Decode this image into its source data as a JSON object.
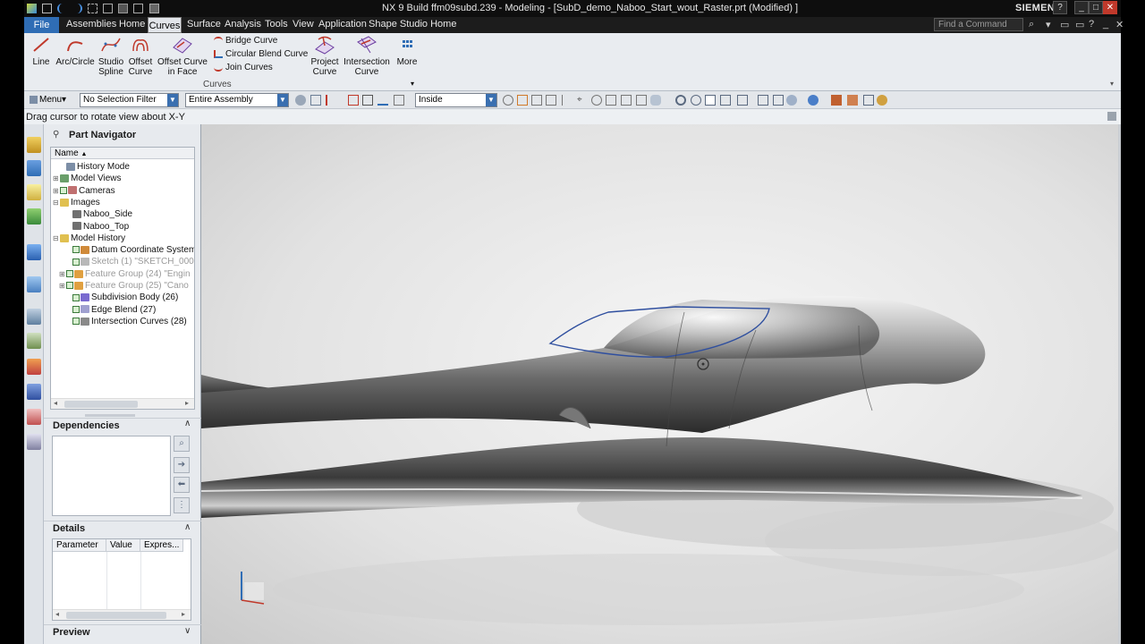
{
  "titlebar": {
    "title": "NX 9  Build ffm09subd.239 - Modeling - [SubD_demo_Naboo_Start_wout_Raster.prt (Modified) ]",
    "brand": "SIEMENS",
    "window_buttons": [
      "?",
      "_",
      "□",
      "✕"
    ]
  },
  "menubar": {
    "file": "File",
    "items": [
      "Assemblies",
      "Home",
      "Curves",
      "Surface",
      "Analysis",
      "Tools",
      "View",
      "Application",
      "Shape Studio Home"
    ],
    "active": "Curves",
    "find_placeholder": "Find a Command"
  },
  "ribbon": {
    "buttons": [
      {
        "label": "Line",
        "icon": "line-icon"
      },
      {
        "label": "Arc/Circle",
        "icon": "arc-icon"
      },
      {
        "label": "Studio\nSpline",
        "icon": "spline-icon"
      },
      {
        "label": "Offset\nCurve",
        "icon": "offset-curve-icon"
      },
      {
        "label": "Offset Curve\nin Face",
        "icon": "offset-in-face-icon"
      },
      {
        "label": "Project\nCurve",
        "icon": "project-curve-icon"
      },
      {
        "label": "Intersection\nCurve",
        "icon": "intersection-curve-icon"
      },
      {
        "label": "More",
        "icon": "more-icon"
      }
    ],
    "small_buttons": [
      "Bridge Curve",
      "Circular Blend Curve",
      "Join Curves"
    ],
    "group_label": "Curves"
  },
  "toolbar": {
    "menu_label": "Menu▾",
    "selection_filter": "No Selection Filter",
    "scope": "Entire Assembly",
    "inside": "Inside"
  },
  "status": {
    "message": "Drag cursor to rotate view about X-Y"
  },
  "navigator": {
    "title": "Part Navigator",
    "column": "Name",
    "rows": [
      {
        "label": "History Mode",
        "indent": 1,
        "twisty": "",
        "check": false,
        "icon": "clock-icon",
        "dim": false
      },
      {
        "label": "Model Views",
        "indent": 0,
        "twisty": "+",
        "check": false,
        "icon": "views-icon",
        "dim": false
      },
      {
        "label": "Cameras",
        "indent": 0,
        "twisty": "+",
        "check": true,
        "icon": "camera-icon",
        "dim": false
      },
      {
        "label": "Images",
        "indent": 0,
        "twisty": "-",
        "check": false,
        "icon": "folder-icon",
        "dim": false
      },
      {
        "label": "Naboo_Side",
        "indent": 2,
        "twisty": "",
        "check": false,
        "icon": "image-icon",
        "dim": false
      },
      {
        "label": "Naboo_Top",
        "indent": 2,
        "twisty": "",
        "check": false,
        "icon": "image-icon",
        "dim": false
      },
      {
        "label": "Model History",
        "indent": 0,
        "twisty": "-",
        "check": false,
        "icon": "folder-icon",
        "dim": false
      },
      {
        "label": "Datum Coordinate System",
        "indent": 2,
        "twisty": "",
        "check": true,
        "icon": "datum-icon",
        "dim": false
      },
      {
        "label": "Sketch (1) \"SKETCH_000",
        "indent": 2,
        "twisty": "",
        "check": true,
        "icon": "sketch-icon",
        "dim": true
      },
      {
        "label": "Feature Group (24) \"Engin",
        "indent": 1,
        "twisty": "+",
        "check": true,
        "icon": "feature-group-icon",
        "dim": true
      },
      {
        "label": "Feature Group (25) \"Cano",
        "indent": 1,
        "twisty": "+",
        "check": true,
        "icon": "feature-group-icon",
        "dim": true
      },
      {
        "label": "Subdivision Body (26)",
        "indent": 2,
        "twisty": "",
        "check": true,
        "icon": "subdivision-icon",
        "dim": false
      },
      {
        "label": "Edge Blend (27)",
        "indent": 2,
        "twisty": "",
        "check": true,
        "icon": "edge-blend-icon",
        "dim": false
      },
      {
        "label": "Intersection Curves (28)",
        "indent": 2,
        "twisty": "",
        "check": true,
        "icon": "intersection-icon",
        "dim": false
      }
    ]
  },
  "dependencies": {
    "title": "Dependencies"
  },
  "details": {
    "title": "Details",
    "columns": [
      "Parameter",
      "Value",
      "Expres..."
    ]
  },
  "preview": {
    "title": "Preview"
  },
  "colors": {
    "accent": "#2f6db5",
    "titlebar": "#0e0e0e",
    "ribbon": "#e9ecf0"
  }
}
